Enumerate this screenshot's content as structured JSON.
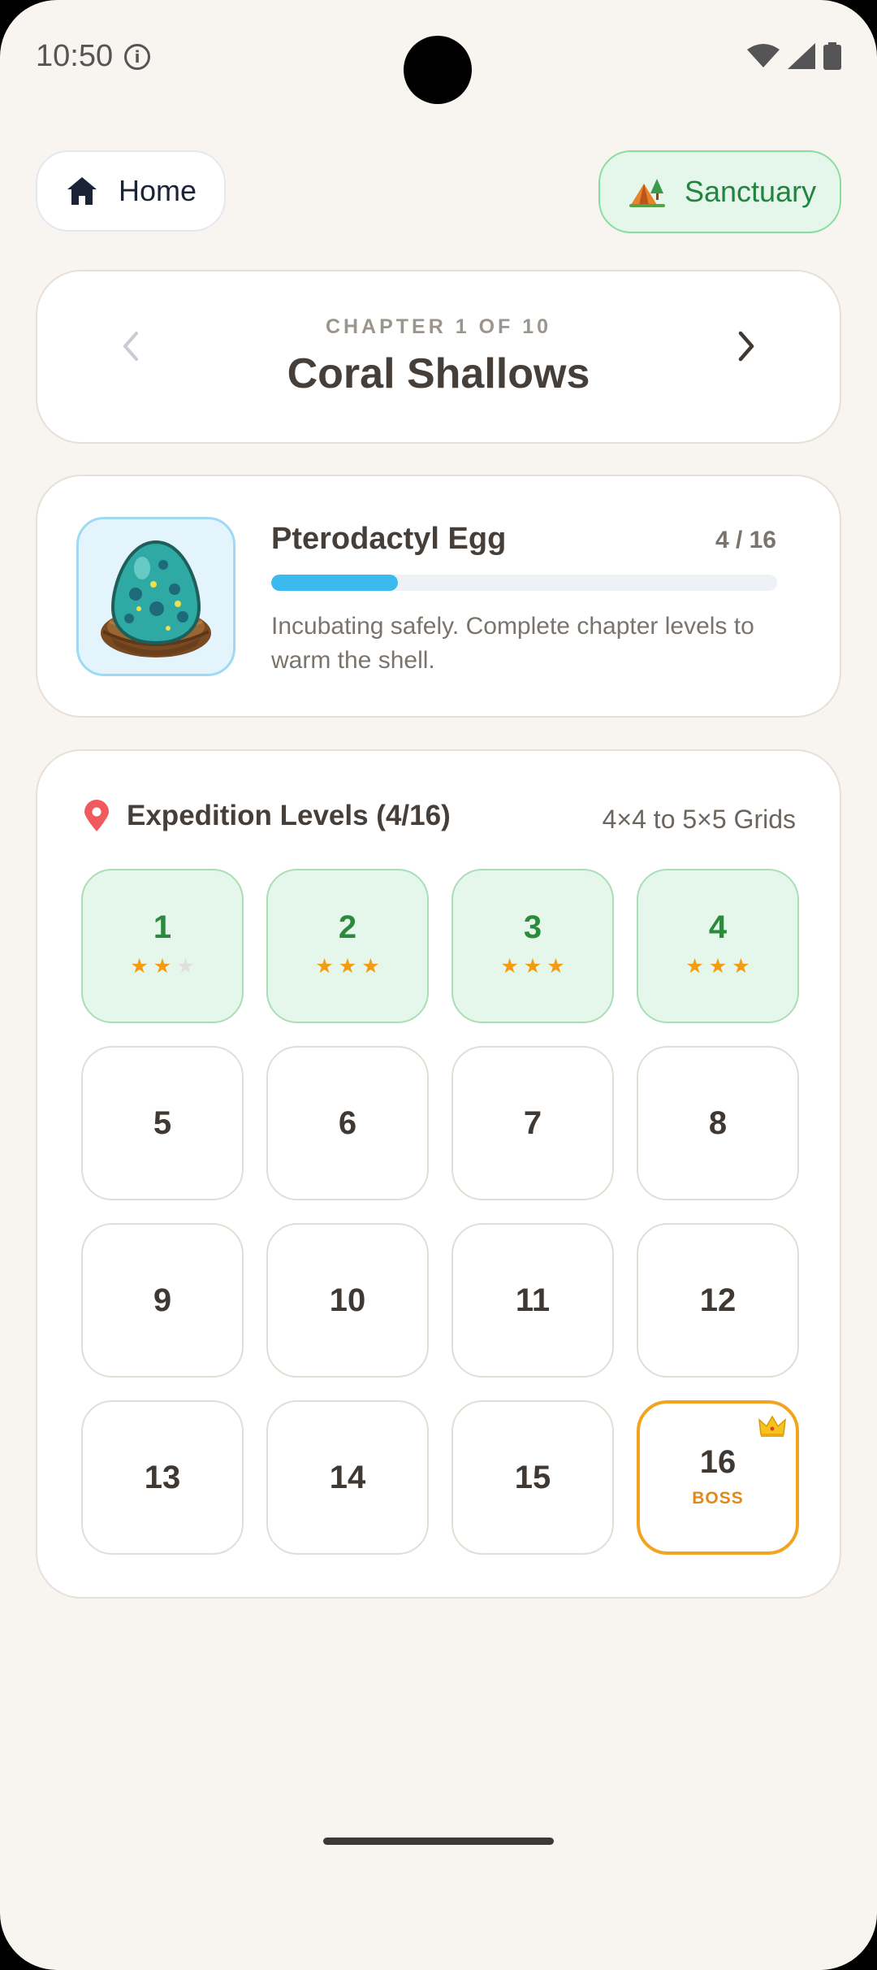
{
  "status_bar": {
    "time": "10:50"
  },
  "header": {
    "home_label": "Home",
    "sanctuary_label": "Sanctuary"
  },
  "chapter": {
    "subtitle": "CHAPTER 1 OF 10",
    "title": "Coral Shallows"
  },
  "egg": {
    "name": "Pterodactyl Egg",
    "progress_text": "4 / 16",
    "progress_fraction": 0.25,
    "description": "Incubating safely. Complete chapter levels to warm the shell."
  },
  "levels": {
    "heading": "Expedition Levels (4/16)",
    "grid_info": "4×4 to 5×5 Grids",
    "boss_label": "BOSS",
    "items": [
      {
        "number": "1",
        "stars": 2,
        "completed": true
      },
      {
        "number": "2",
        "stars": 3,
        "completed": true
      },
      {
        "number": "3",
        "stars": 3,
        "completed": true
      },
      {
        "number": "4",
        "stars": 3,
        "completed": true
      },
      {
        "number": "5",
        "stars": 0,
        "completed": false
      },
      {
        "number": "6",
        "stars": 0,
        "completed": false
      },
      {
        "number": "7",
        "stars": 0,
        "completed": false
      },
      {
        "number": "8",
        "stars": 0,
        "completed": false
      },
      {
        "number": "9",
        "stars": 0,
        "completed": false
      },
      {
        "number": "10",
        "stars": 0,
        "completed": false
      },
      {
        "number": "11",
        "stars": 0,
        "completed": false
      },
      {
        "number": "12",
        "stars": 0,
        "completed": false
      },
      {
        "number": "13",
        "stars": 0,
        "completed": false
      },
      {
        "number": "14",
        "stars": 0,
        "completed": false
      },
      {
        "number": "15",
        "stars": 0,
        "completed": false
      },
      {
        "number": "16",
        "stars": 0,
        "completed": false,
        "boss": true
      }
    ]
  },
  "colors": {
    "background": "#f8f5f0",
    "completed_accent": "#2b8a3e",
    "progress_fill": "#3cbaf0",
    "boss_accent": "#f3a41e",
    "star": "#f39c12"
  },
  "icons": [
    "info-icon",
    "wifi-icon",
    "signal-icon",
    "battery-icon",
    "home-icon",
    "tent-icon",
    "chevron-left-icon",
    "chevron-right-icon",
    "egg-nest-icon",
    "location-pin-icon",
    "star-icon",
    "crown-icon"
  ]
}
